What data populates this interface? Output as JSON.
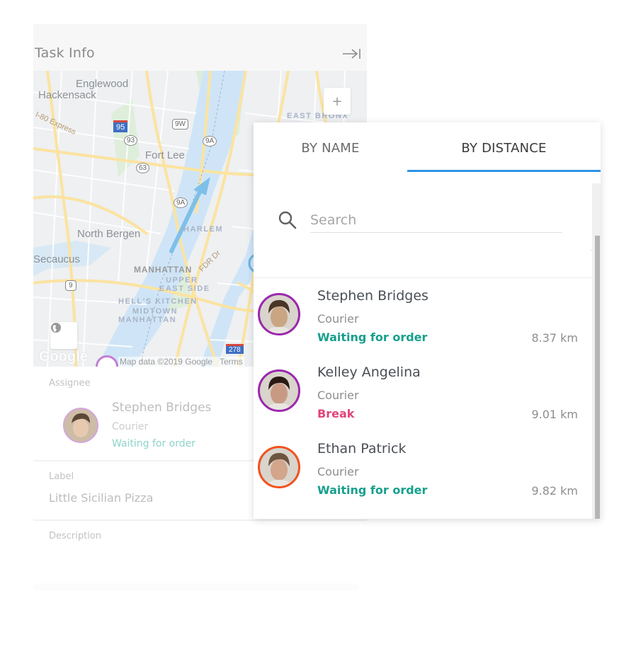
{
  "task_panel": {
    "title": "Task Info",
    "collapse_icon": "arrow-to-right-icon",
    "map": {
      "labels": {
        "englewood": "Englewood",
        "hackensack": "Hackensack",
        "i80": "I-80 Express",
        "fort_lee": "Fort Lee",
        "east_bronx": "EAST BRONX",
        "north_bergen": "North Bergen",
        "harlem": "HARLEM",
        "secaucus": "Secaucus",
        "manhattan": "MANHATTAN",
        "upper_east": "UPPER",
        "upper_east2": "EAST SIDE",
        "hells_kitchen": "HELL'S KITCHEN",
        "midtown": "MIDTOWN",
        "midtown2": "MANHATTAN",
        "fdr": "FDR Dr"
      },
      "shields": {
        "i95": "95",
        "r93": "93",
        "r9w": "9W",
        "r9a_top": "9A",
        "r63": "63",
        "r9a_mid": "9A",
        "us9": "9",
        "i278": "278"
      },
      "zoom_in_label": "+",
      "globe_icon": "globe-icon",
      "logo": "Google",
      "attribution": "Map data ©2019 Google",
      "terms": "Terms"
    },
    "assignee": {
      "section_label": "Assignee",
      "name": "Stephen Bridges",
      "role": "Courier",
      "status": "Waiting for order"
    },
    "label": {
      "section_label": "Label",
      "value": "Little Sicilian Pizza"
    },
    "description": {
      "section_label": "Description"
    }
  },
  "picker": {
    "tabs": [
      {
        "label": "BY NAME",
        "active": false
      },
      {
        "label": "BY DISTANCE",
        "active": true
      }
    ],
    "accent_color": "#2f93e8",
    "search": {
      "placeholder": "Search",
      "value": ""
    },
    "couriers": [
      {
        "name": "Stephen Bridges",
        "role": "Courier",
        "status": "Waiting for order",
        "status_color": "#17a08c",
        "distance": "8.37 km",
        "ring_color": "#9b27b0",
        "skin": "#c9a582",
        "hair": "#4a3526"
      },
      {
        "name": "Kelley Angelina",
        "role": "Courier",
        "status": "Break",
        "status_color": "#e2437a",
        "distance": "9.01 km",
        "ring_color": "#9b27b0",
        "skin": "#c89a84",
        "hair": "#2a1a14"
      },
      {
        "name": "Ethan Patrick",
        "role": "Courier",
        "status": "Waiting for order",
        "status_color": "#17a08c",
        "distance": "9.82 km",
        "ring_color": "#f4511e",
        "skin": "#d3a58a",
        "hair": "#6d5540"
      }
    ]
  }
}
